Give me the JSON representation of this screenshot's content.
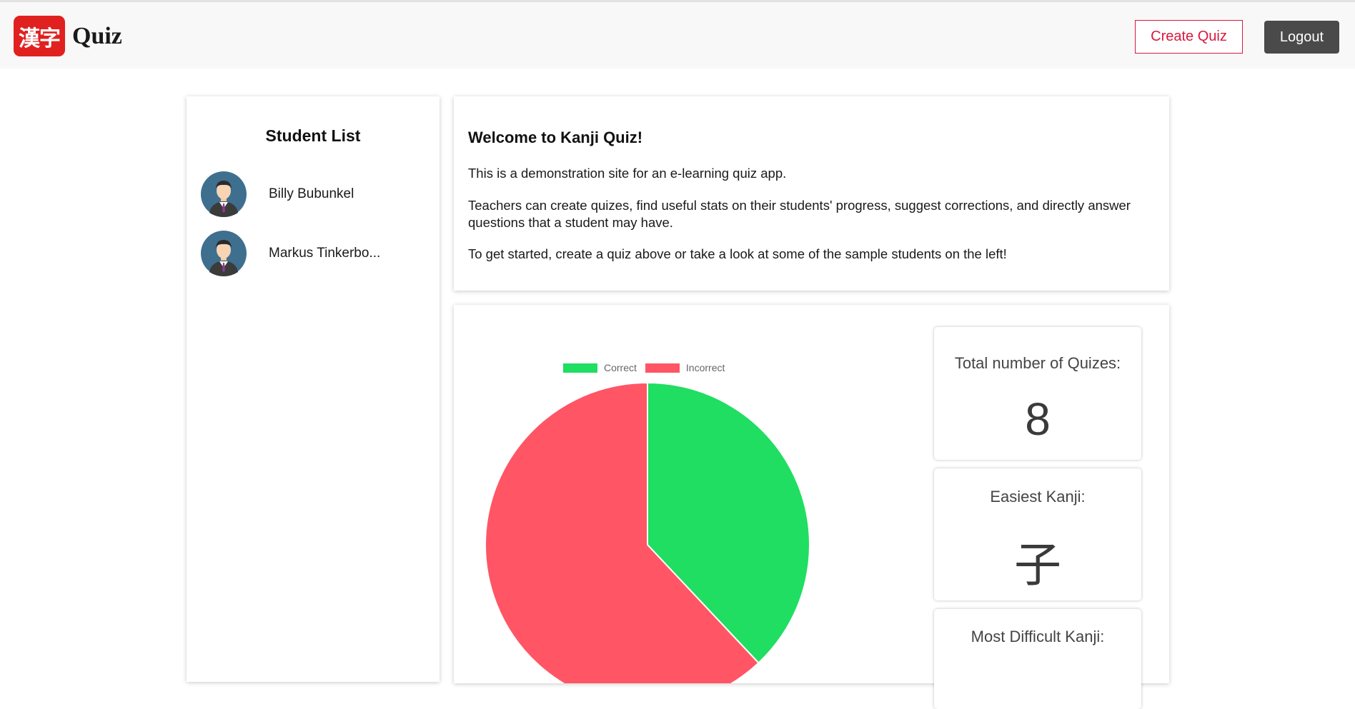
{
  "header": {
    "logo_text": "漢字",
    "brand_text": "Quiz",
    "create_quiz_label": "Create Quiz",
    "logout_label": "Logout"
  },
  "sidebar": {
    "title": "Student List",
    "students": [
      {
        "name": "Billy Bubunkel",
        "avatar": "student-avatar-icon"
      },
      {
        "name": "Markus Tinkerbo...",
        "avatar": "student-avatar-icon"
      }
    ]
  },
  "welcome": {
    "title": "Welcome to Kanji Quiz!",
    "paragraphs": [
      "This is a demonstration site for an e-learning quiz app.",
      "Teachers can create quizes, find useful stats on their students' progress, suggest corrections, and directly answer questions that a student may have.",
      "To get started, create a quiz above or take a look at some of the sample students on the left!"
    ]
  },
  "stats": {
    "total_label": "Total number of Quizes:",
    "total_value": "8",
    "easiest_label": "Easiest Kanji:",
    "easiest_value": "子",
    "hardest_label": "Most Difficult Kanji:"
  },
  "colors": {
    "brand_red": "#e0211f",
    "create_button": "#d8193d",
    "logout_button": "#4a4a4a",
    "correct": "#1fde61",
    "incorrect": "#ff5565"
  },
  "chart_data": {
    "type": "pie",
    "categories": [
      "Correct",
      "Incorrect"
    ],
    "values": [
      38,
      62
    ],
    "legend": "top",
    "title": ""
  }
}
